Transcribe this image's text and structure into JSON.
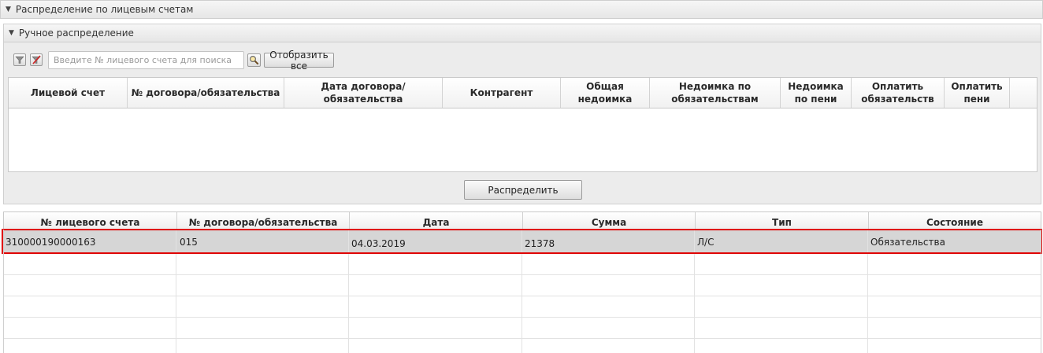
{
  "outer_panel": {
    "title": "Распределение по лицевым счетам"
  },
  "manual_panel": {
    "title": "Ручное распределение",
    "search": {
      "placeholder": "Введите № лицевого счета для поиска",
      "value": ""
    },
    "show_all_label": "Отобразить все",
    "columns": [
      "Лицевой счет",
      "№ договора/обязательства",
      "Дата договора/обязательства",
      "Контрагент",
      "Общая недоимка",
      "Недоимка по обязательствам",
      "Недоимка по пени",
      "Оплатить обязательств",
      "Оплатить пени"
    ],
    "distribute_label": "Распределить"
  },
  "lower_table": {
    "columns": [
      "№ лицевого счета",
      "№ договора/обязательства",
      "Дата",
      "Сумма",
      "Тип",
      "Состояние"
    ],
    "rows": [
      {
        "account": "310000190000163",
        "contract": "015",
        "date": "04.03.2019",
        "sum": "21378",
        "type": "Л/С",
        "state": "Обязательства",
        "selected": true
      }
    ]
  },
  "colors": {
    "highlight_border": "#e00000",
    "selected_row": "#d6d6d6"
  },
  "icons": [
    "collapse-triangle-icon",
    "filter-icon",
    "clear-filter-icon",
    "search-magnifier-icon"
  ]
}
